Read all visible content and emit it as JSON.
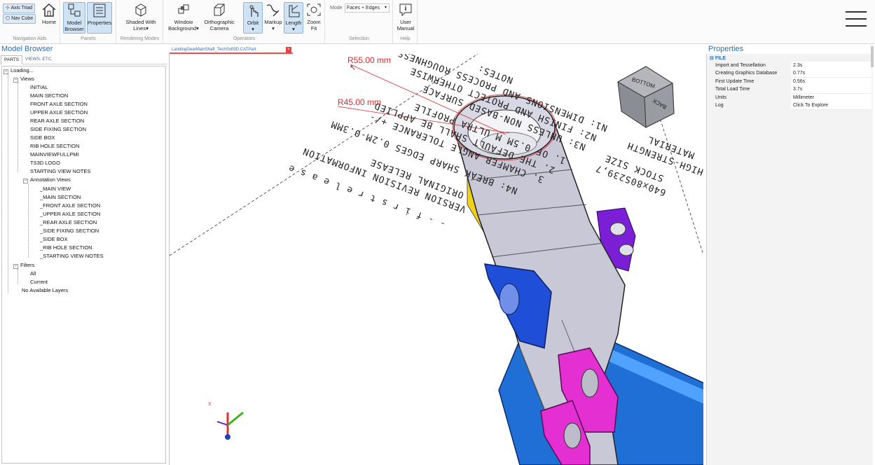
{
  "ribbon": {
    "navigation_aids": {
      "label": "Navigation Aids",
      "axis_triad": "Axis Triad",
      "nav_cube": "Nav Cube",
      "home": "Home"
    },
    "panels": {
      "label": "Panels",
      "model_browser": "Model Browser",
      "properties": "Properties"
    },
    "rendering_modes": {
      "label": "Rendering Modes",
      "shaded": "Shaded With Lines"
    },
    "operators": {
      "label": "Operators",
      "window_background": "Window Background",
      "orthographic_camera": "Orthographic Camera",
      "orbit": "Orbit",
      "markup": "Markup",
      "length": "Length",
      "zoom_fit": "Zoom Fit"
    },
    "selection": {
      "label": "Selection",
      "mode_label": "Mode",
      "mode_value": "Faces + Edges"
    },
    "help": {
      "label": "Help",
      "user_manual": "User Manual"
    }
  },
  "model_browser": {
    "title": "Model Browser",
    "tabs": [
      "PARTS",
      "VIEWS, ETC"
    ],
    "tree": {
      "root": "Loading...",
      "views_label": "Views",
      "views": [
        "INITIAL",
        "MAIN SECTION",
        "FRONT AXLE SECTION",
        "UPPER AXLE SECTION",
        "REAR AXLE SECTION",
        "SIDE FIXING SECTION",
        "SIDE BOX",
        "RIB HOLE SECTION",
        "MAINVIEWFULLPMI",
        "TS3D LOGO",
        "STARTING VIEW NOTES"
      ],
      "annotation_views_label": "Annotation Views",
      "annotation_views": [
        "_MAIN VIEW",
        "_MAIN SECTION",
        "_FRONT AXLE SECTION",
        "_UPPER AXLE SECTION",
        "_REAR AXLE SECTION",
        "_SIDE FIXING SECTION",
        "_SIDE BOX",
        "_RIB HOLE SECTION",
        "_STARTING VIEW NOTES"
      ],
      "filters_label": "Filters",
      "filters": [
        "All",
        "Current"
      ],
      "layers": "No Available Layers"
    }
  },
  "viewport": {
    "doc_tab": "LandingGearMainShaft_TechSoft3D.CATPart",
    "annotations": {
      "r55": "R55.00 mm",
      "r45": "R45.00 mm"
    },
    "nav_cube": {
      "top_face": "BOTTOM",
      "side_face": "BACK"
    },
    "notes": {
      "first_release": "- - f i r s t   r e l e a s e",
      "version_header": "VERSION REVISION INFORMATION",
      "original_release": "ORIGINAL RELEASE",
      "n4": "N4: BREAK SHARP EDGES 0.2M-0.3MM",
      "l3": "3. CHAMFER ANGLE TOLERANCE +/-",
      "l2": "2. THE DEFAULT SHALL BE APPLIED",
      "l1": "1. OF 0.5M M ULTRA PROFILE",
      "n3": "N3: UNLESS NON-BASED SURFACE",
      "n2": "N2: FINISH AND PROTECT OTHERWISE",
      "n1": "N1: DIMENSIONS AND PROCESS ROUGHNESS",
      "notes_label": "NOTES:",
      "stock": "STOCK SIZE",
      "stock_value": "640x80S239,7",
      "material": "MATERIAL",
      "high": "HIGH-STRENGTH"
    },
    "triad": {
      "x": "X"
    },
    "colors": {
      "annot_red": "#d42a2a",
      "part_grey": "#c9c8d6",
      "part_blue": "#1f6fd6",
      "part_purple": "#7b1fd6",
      "part_magenta": "#e42fd2",
      "part_yellow": "#f1d21a"
    }
  },
  "properties": {
    "title": "Properties",
    "group": "FILE",
    "rows": [
      {
        "k": "Import and Tessellation",
        "v": "2.3s"
      },
      {
        "k": "Creating Graphics Database",
        "v": "0.77s"
      },
      {
        "k": "First Update Time",
        "v": "0.56s"
      },
      {
        "k": "Total Load Time",
        "v": "3.7s"
      },
      {
        "k": "Units",
        "v": "Millimeter"
      },
      {
        "k": "Log",
        "v": "Click To Explore"
      }
    ]
  }
}
